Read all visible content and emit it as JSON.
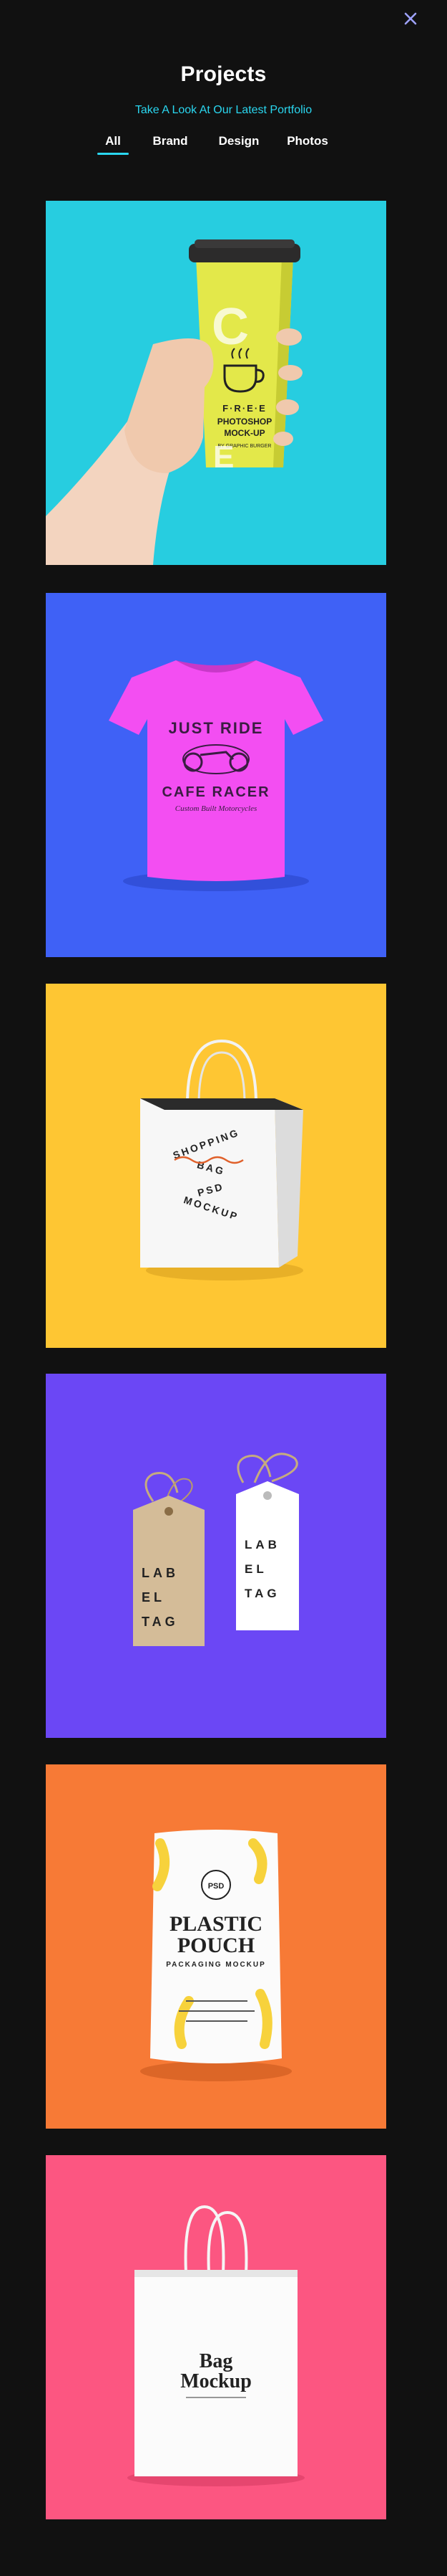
{
  "header": {
    "title": "Projects",
    "subtitle": "Take A Look At Our Latest Portfolio",
    "close_icon": "close-icon"
  },
  "tabs": [
    {
      "label": "All",
      "active": true
    },
    {
      "label": "Brand",
      "active": false
    },
    {
      "label": "Design",
      "active": false
    },
    {
      "label": "Photos",
      "active": false
    }
  ],
  "colors": {
    "background": "#111111",
    "accent": "#2ad7f0",
    "close": "#9ea2ff"
  },
  "portfolio": [
    {
      "kind": "coffee-cup-mockup",
      "bg": "#27cde0",
      "text": {
        "big": "C",
        "big2": "E",
        "line1": "F·R·E·E",
        "line2": "PHOTOSHOP",
        "line3": "MOCK-UP",
        "line4": "BY GRAPHIC BURGER"
      }
    },
    {
      "kind": "tshirt-mockup",
      "bg": "#3f61f6",
      "text": {
        "line1": "JUST RIDE",
        "line2": "CAFE RACER",
        "line3": "Custom Built Motorcycles"
      }
    },
    {
      "kind": "shopping-bag-mockup",
      "bg": "#fec633",
      "text": {
        "line1": "SHOPPING",
        "line2": "BAG",
        "line3": "PSD",
        "line4": "MOCKUP"
      }
    },
    {
      "kind": "label-tag-mockup",
      "bg": "#6b47f5",
      "text": {
        "tag1": [
          "LAB",
          "EL",
          "TAG"
        ],
        "tag2": [
          "LAB",
          "EL",
          "TAG"
        ]
      }
    },
    {
      "kind": "plastic-pouch-mockup",
      "bg": "#f77a36",
      "text": {
        "badge": "PSD",
        "line1": "PLASTIC",
        "line2": "POUCH",
        "line3": "PACKAGING MOCKUP"
      }
    },
    {
      "kind": "bag-mockup",
      "bg": "#fc5681",
      "text": {
        "line1": "Bag",
        "line2": "Mockup"
      }
    }
  ]
}
